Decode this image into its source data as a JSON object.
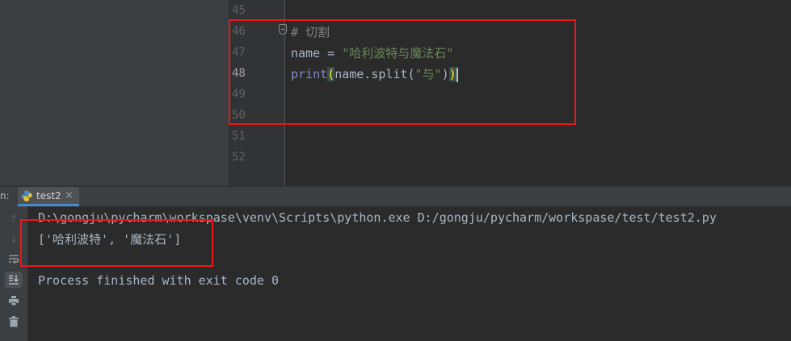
{
  "editor": {
    "line_numbers": [
      "45",
      "46",
      "47",
      "48",
      "49",
      "50",
      "51",
      "52"
    ],
    "current_line": "48",
    "code": {
      "line46_comment": "# 切割",
      "line47_prefix": "name = ",
      "line47_string": "\"哈利波特与魔法石\"",
      "line48_keyword": "print",
      "line48_open": "(",
      "line48_middle": "name.split(",
      "line48_string": "\"与\"",
      "line48_inner_close": ")",
      "line48_close": ")"
    }
  },
  "run_panel": {
    "label": "n:",
    "tab_label": "test2",
    "tab_close": "×",
    "toolbar_icons": [
      "arrow-up-icon",
      "arrow-down-icon",
      "soft-wrap-icon",
      "scroll-to-end-icon",
      "print-icon",
      "trash-icon"
    ],
    "console": {
      "command": "D:\\gongju\\pycharm\\workspase\\venv\\Scripts\\python.exe D:/gongju/pycharm/workspase/test/test2.py",
      "output": "['哈利波特', '魔法石']",
      "exit_message": "Process finished with exit code 0"
    }
  },
  "colors": {
    "highlight_box": "#e8191c",
    "background": "#2b2b2b",
    "keyword": "#8888c6",
    "string": "#6a8759",
    "comment": "#808080"
  }
}
